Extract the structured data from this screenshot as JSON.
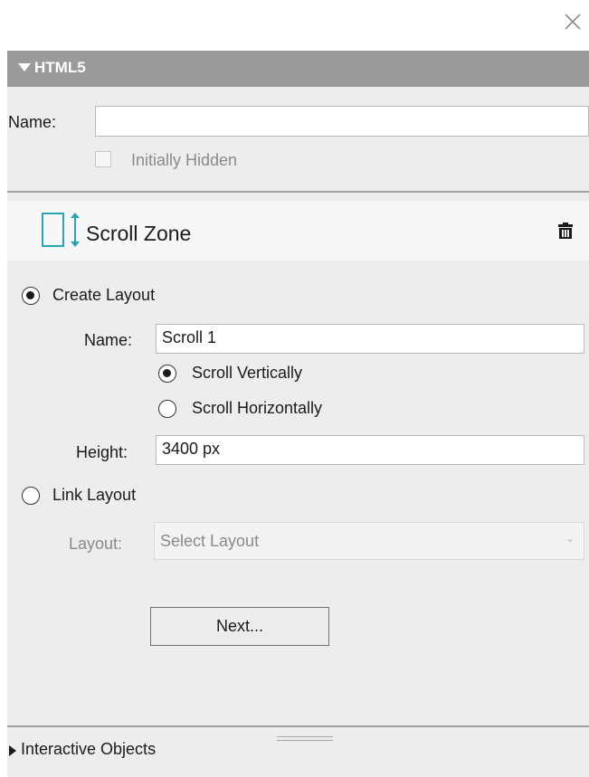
{
  "window": {
    "close_icon": "close-icon"
  },
  "html5_section": {
    "title": "HTML5",
    "name_label": "Name:",
    "name_value": "",
    "initially_hidden_label": "Initially Hidden",
    "initially_hidden_checked": false
  },
  "scroll_zone": {
    "icon": "scroll-zone-icon",
    "label": "Scroll Zone",
    "delete_icon": "trash-icon"
  },
  "create_layout": {
    "label": "Create Layout",
    "selected": true,
    "name_label": "Name:",
    "name_value": "Scroll 1",
    "scroll_vertically_label": "Scroll Vertically",
    "scroll_vertically_selected": true,
    "scroll_horizontally_label": "Scroll Horizontally",
    "scroll_horizontally_selected": false,
    "height_label": "Height:",
    "height_value": "3400 px"
  },
  "link_layout": {
    "label": "Link Layout",
    "selected": false,
    "layout_label": "Layout:",
    "layout_value": "Select Layout"
  },
  "next_button_label": "Next...",
  "footer": {
    "interactive_objects_label": "Interactive Objects"
  },
  "colors": {
    "accent": "#2aa3b5",
    "header": "#9a9a9a",
    "panel": "#ededed"
  }
}
